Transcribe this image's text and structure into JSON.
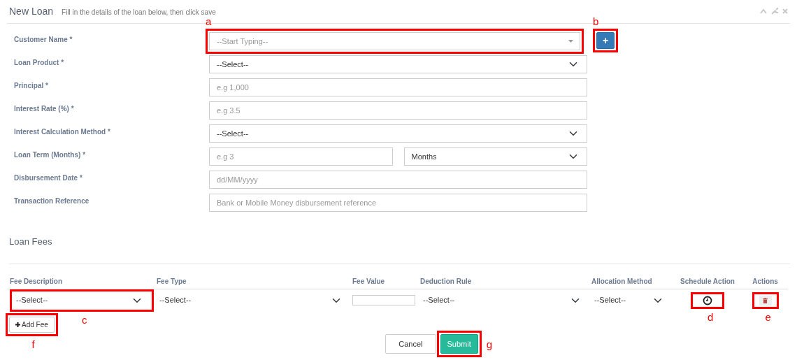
{
  "panel": {
    "title": "New Loan",
    "subtitle": "Fill in the details of the loan below, then click save"
  },
  "form": {
    "fields": [
      {
        "label": "Customer Name *",
        "controls": [
          {
            "kind": "typeahead",
            "placeholder": "--Start Typing--",
            "callout": {
              "letter": "a"
            }
          }
        ],
        "add_button": {
          "label": "+",
          "callout": {
            "letter": "b"
          }
        }
      },
      {
        "label": "Loan Product *",
        "controls": [
          {
            "kind": "select",
            "value": "--Select--"
          }
        ]
      },
      {
        "label": "Principal *",
        "controls": [
          {
            "kind": "input",
            "placeholder": "e.g 1,000"
          }
        ]
      },
      {
        "label": "Interest Rate (%) *",
        "controls": [
          {
            "kind": "input",
            "placeholder": "e.g 3.5"
          }
        ]
      },
      {
        "label": "Interest Calculation Method *",
        "controls": [
          {
            "kind": "select",
            "value": "--Select--"
          }
        ]
      },
      {
        "label": "Loan Term (Months) *",
        "controls": [
          {
            "kind": "input",
            "placeholder": "e.g 3"
          },
          {
            "kind": "select",
            "value": "Months"
          }
        ]
      },
      {
        "label": "Disbursement Date *",
        "controls": [
          {
            "kind": "input",
            "placeholder": "dd/MM/yyyy"
          }
        ]
      },
      {
        "label": "Transaction Reference",
        "controls": [
          {
            "kind": "input",
            "placeholder": "Bank or Mobile Money disbursement reference"
          }
        ]
      }
    ]
  },
  "fees": {
    "title": "Loan Fees",
    "columns": [
      "Fee Description",
      "Fee Type",
      "Fee Value",
      "Deduction Rule",
      "Allocation Method",
      "Schedule Action",
      "Actions"
    ],
    "rows": [
      {
        "cells": [
          {
            "kind": "select",
            "value": "--Select--",
            "callout": {
              "letter": "c"
            }
          },
          {
            "kind": "select",
            "value": "--Select--"
          },
          {
            "kind": "input"
          },
          {
            "kind": "select",
            "value": "--Select--"
          },
          {
            "kind": "select",
            "value": "--Select--"
          },
          {
            "kind": "schedule",
            "callout": {
              "letter": "d"
            }
          },
          {
            "kind": "delete",
            "callout": {
              "letter": "e"
            }
          }
        ]
      }
    ],
    "add_button": {
      "label": "Add Fee",
      "callout": {
        "letter": "f"
      }
    }
  },
  "actions": [
    {
      "label": "Cancel",
      "kind": "secondary"
    },
    {
      "label": "Submit",
      "kind": "primary",
      "callout": {
        "letter": "g"
      }
    }
  ]
}
